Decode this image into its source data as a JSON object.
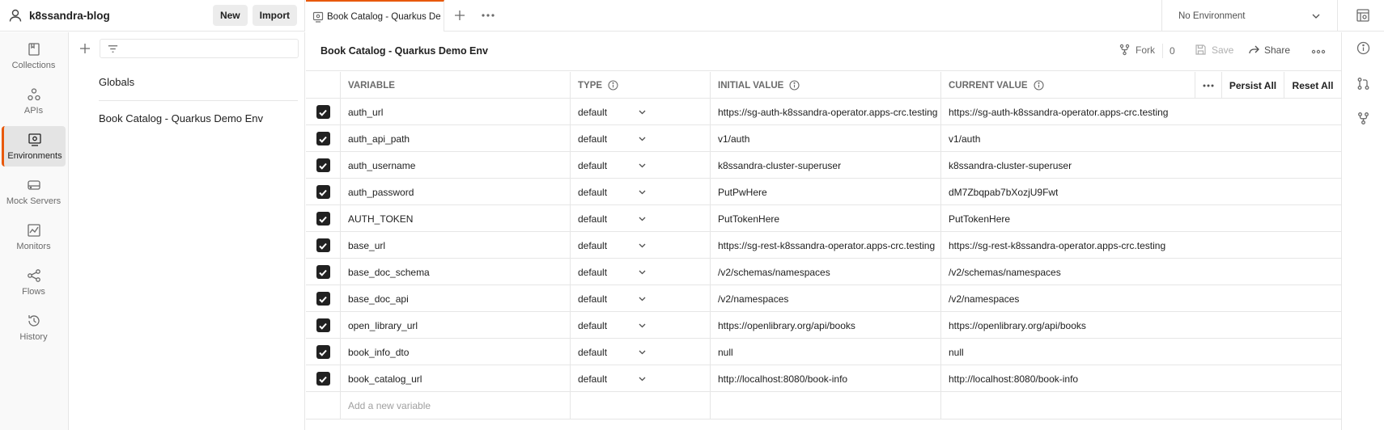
{
  "workspace": {
    "name": "k8ssandra-blog",
    "new_label": "New",
    "import_label": "Import"
  },
  "rail": {
    "items": [
      {
        "label": "Collections",
        "icon": "collections-icon"
      },
      {
        "label": "APIs",
        "icon": "apis-icon"
      },
      {
        "label": "Environments",
        "icon": "environments-icon",
        "active": true
      },
      {
        "label": "Mock Servers",
        "icon": "mock-servers-icon"
      },
      {
        "label": "Monitors",
        "icon": "monitors-icon"
      },
      {
        "label": "Flows",
        "icon": "flows-icon"
      },
      {
        "label": "History",
        "icon": "history-icon"
      }
    ]
  },
  "sidebar": {
    "globals_label": "Globals",
    "environments": [
      "Book Catalog - Quarkus Demo Env"
    ]
  },
  "tabs": {
    "active_tab_label": "Book Catalog - Quarkus Demo Env",
    "environment_selector": "No Environment"
  },
  "env_header": {
    "title": "Book Catalog - Quarkus Demo Env",
    "fork_label": "Fork",
    "fork_count": "0",
    "save_label": "Save",
    "share_label": "Share"
  },
  "table": {
    "headers": {
      "variable": "VARIABLE",
      "type": "TYPE",
      "initial_value": "INITIAL VALUE",
      "current_value": "CURRENT VALUE"
    },
    "persist_all_label": "Persist All",
    "reset_all_label": "Reset All",
    "add_placeholder": "Add a new variable",
    "rows": [
      {
        "variable": "auth_url",
        "type": "default",
        "initial": "https://sg-auth-k8ssandra-operator.apps-crc.testing",
        "current": "https://sg-auth-k8ssandra-operator.apps-crc.testing"
      },
      {
        "variable": "auth_api_path",
        "type": "default",
        "initial": "v1/auth",
        "current": "v1/auth"
      },
      {
        "variable": "auth_username",
        "type": "default",
        "initial": "k8ssandra-cluster-superuser",
        "current": "k8ssandra-cluster-superuser"
      },
      {
        "variable": "auth_password",
        "type": "default",
        "initial": "PutPwHere",
        "current": "dM7Zbqpab7bXozjU9Fwt"
      },
      {
        "variable": "AUTH_TOKEN",
        "type": "default",
        "initial": "PutTokenHere",
        "current": "PutTokenHere"
      },
      {
        "variable": "base_url",
        "type": "default",
        "initial": "https://sg-rest-k8ssandra-operator.apps-crc.testing",
        "current": "https://sg-rest-k8ssandra-operator.apps-crc.testing"
      },
      {
        "variable": "base_doc_schema",
        "type": "default",
        "initial": "/v2/schemas/namespaces",
        "current": "/v2/schemas/namespaces"
      },
      {
        "variable": "base_doc_api",
        "type": "default",
        "initial": "/v2/namespaces",
        "current": "/v2/namespaces"
      },
      {
        "variable": "open_library_url",
        "type": "default",
        "initial": "https://openlibrary.org/api/books",
        "current": "https://openlibrary.org/api/books"
      },
      {
        "variable": "book_info_dto",
        "type": "default",
        "initial": "null",
        "current": "null"
      },
      {
        "variable": "book_catalog_url",
        "type": "default",
        "initial": "http://localhost:8080/book-info",
        "current": "http://localhost:8080/book-info"
      }
    ]
  }
}
